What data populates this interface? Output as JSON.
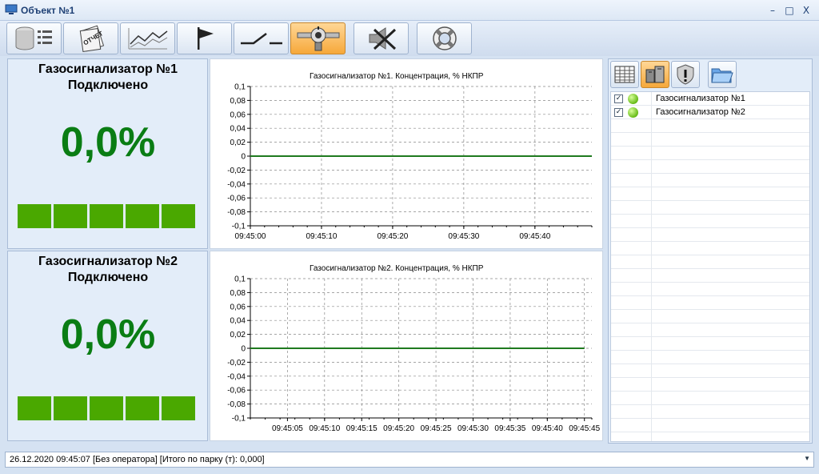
{
  "window": {
    "title": "Объект №1",
    "minimize": "–",
    "maximize": "□",
    "close": "X"
  },
  "toolbar": {
    "active_index": 5,
    "buttons": [
      {
        "icon": "database-list-icon"
      },
      {
        "icon": "report-icon",
        "label": "ОТЧЕТ"
      },
      {
        "icon": "trend-chart-icon"
      },
      {
        "icon": "flag-icon"
      },
      {
        "icon": "switch-icon"
      },
      {
        "icon": "gas-sensor-icon"
      },
      {
        "icon": "alarm-off-icon"
      },
      {
        "icon": "lifebuoy-icon"
      }
    ]
  },
  "sensors": [
    {
      "title": "Газосигнализатор №1",
      "status": "Подключено",
      "value": "0,0%",
      "level": 0,
      "segments": 5,
      "chart_title": "Газосигнализатор №1. Концентрация, % НКПР"
    },
    {
      "title": "Газосигнализатор №2",
      "status": "Подключено",
      "value": "0,0%",
      "level": 0,
      "segments": 5,
      "chart_title": "Газосигнализатор №2. Концентрация, % НКПР"
    }
  ],
  "chart_data": [
    {
      "type": "line",
      "title": "Газосигнализатор №1. Концентрация, % НКПР",
      "xlabel": "",
      "ylabel": "",
      "ylim": [
        -0.1,
        0.1
      ],
      "yticks": [
        "0,1",
        "0,08",
        "0,06",
        "0,04",
        "0,02",
        "0",
        "-0,02",
        "-0,04",
        "-0,06",
        "-0,08",
        "-0,1"
      ],
      "xticks": [
        "09:45:00",
        "09:45:10",
        "09:45:20",
        "09:45:30",
        "09:45:40"
      ],
      "grid": true,
      "line_color": "#1f7a1f",
      "series": [
        {
          "x": [
            "09:45:00",
            "09:45:48"
          ],
          "values": [
            0,
            0
          ]
        }
      ]
    },
    {
      "type": "line",
      "title": "Газосигнализатор №2. Концентрация, % НКПР",
      "xlabel": "",
      "ylabel": "",
      "ylim": [
        -0.1,
        0.1
      ],
      "yticks": [
        "0,1",
        "0,08",
        "0,06",
        "0,04",
        "0,02",
        "0",
        "-0,02",
        "-0,04",
        "-0,06",
        "-0,08",
        "-0,1"
      ],
      "xticks": [
        "09:45:05",
        "09:45:10",
        "09:45:15",
        "09:45:20",
        "09:45:25",
        "09:45:30",
        "09:45:35",
        "09:45:40",
        "09:45:45"
      ],
      "grid": true,
      "line_color": "#1f7a1f",
      "series": [
        {
          "x": [
            "09:45:00",
            "09:45:45"
          ],
          "values": [
            0,
            0
          ]
        }
      ]
    }
  ],
  "right_panel": {
    "toolbar": [
      {
        "icon": "table-icon"
      },
      {
        "icon": "devices-icon"
      },
      {
        "icon": "warning-shield-icon"
      },
      {
        "icon": "folder-icon"
      }
    ],
    "items": [
      {
        "checked": true,
        "mark": "✓",
        "name": "Газосигнализатор №1"
      },
      {
        "checked": true,
        "mark": "✓",
        "name": "Газосигнализатор №2"
      }
    ]
  },
  "status": {
    "text": "26.12.2020 09:45:07 [Без оператора]  [Итого по парку  (т): 0,000]",
    "dropdown": "▼"
  },
  "colors": {
    "value": "#0a7d14",
    "bar": "#4aa800",
    "accent": "#f6a83a"
  }
}
